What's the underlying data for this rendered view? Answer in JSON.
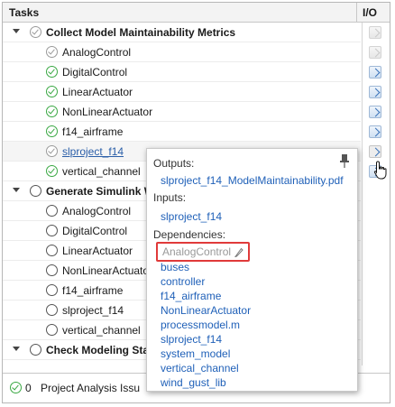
{
  "header": {
    "tasks_label": "Tasks",
    "io_label": "I/O"
  },
  "rows": [
    {
      "label": "Collect Model Maintainability Metrics",
      "type": "group",
      "status": "gray"
    },
    {
      "label": "AnalogControl",
      "type": "task",
      "status": "gray"
    },
    {
      "label": "DigitalControl",
      "type": "task",
      "status": "done"
    },
    {
      "label": "LinearActuator",
      "type": "task",
      "status": "done"
    },
    {
      "label": "NonLinearActuator",
      "type": "task",
      "status": "done"
    },
    {
      "label": "f14_airframe",
      "type": "task",
      "status": "done"
    },
    {
      "label": "slproject_f14",
      "type": "task",
      "status": "gray",
      "selected": true
    },
    {
      "label": "vertical_channel",
      "type": "task",
      "status": "done"
    },
    {
      "label": "Generate Simulink W",
      "type": "group",
      "status": "empty"
    },
    {
      "label": "AnalogControl",
      "type": "task",
      "status": "empty"
    },
    {
      "label": "DigitalControl",
      "type": "task",
      "status": "empty"
    },
    {
      "label": "LinearActuator",
      "type": "task",
      "status": "empty"
    },
    {
      "label": "NonLinearActuato",
      "type": "task",
      "status": "empty"
    },
    {
      "label": "f14_airframe",
      "type": "task",
      "status": "empty"
    },
    {
      "label": "slproject_f14",
      "type": "task",
      "status": "empty"
    },
    {
      "label": "vertical_channel",
      "type": "task",
      "status": "empty"
    },
    {
      "label": "Check Modeling Sta",
      "type": "group",
      "status": "empty"
    }
  ],
  "footer": {
    "count": "0",
    "text": "Project Analysis Issu"
  },
  "popup": {
    "outputs_label": "Outputs:",
    "outputs": [
      "slproject_f14_ModelMaintainability.pdf"
    ],
    "inputs_label": "Inputs:",
    "inputs": [
      "slproject_f14"
    ],
    "dependencies_label": "Dependencies:",
    "disabled_dependency": "AnalogControl",
    "dependencies": [
      "buses",
      "controller",
      "f14_airframe",
      "NonLinearActuator",
      "processmodel.m",
      "slproject_f14",
      "system_model",
      "vertical_channel",
      "wind_gust_lib"
    ]
  },
  "colors": {
    "link": "#1f60b8",
    "done": "#3aa843",
    "highlight_border": "#e03a3a"
  }
}
